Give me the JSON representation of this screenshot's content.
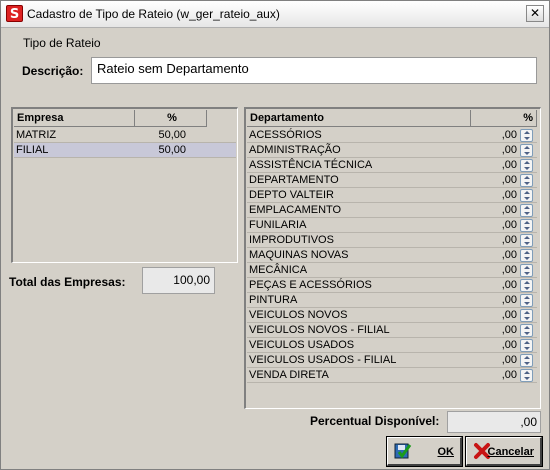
{
  "window": {
    "title": "Cadastro de Tipo de Rateio (w_ger_rateio_aux)",
    "close_glyph": "✕",
    "app_icon_letter": "S"
  },
  "form": {
    "group_title": "Tipo de Rateio",
    "description_label": "Descrição:",
    "description_value": "Rateio sem Departamento"
  },
  "empresas": {
    "headers": {
      "name": "Empresa",
      "pct": "%"
    },
    "rows": [
      {
        "name": "MATRIZ",
        "pct": "50,00"
      },
      {
        "name": "FILIAL",
        "pct": "50,00",
        "selected": true
      }
    ]
  },
  "total": {
    "label": "Total das Empresas:",
    "value": "100,00"
  },
  "departamentos": {
    "headers": {
      "name": "Departamento",
      "pct": "%"
    },
    "rows": [
      {
        "name": "ACESSÓRIOS",
        "pct": ",00"
      },
      {
        "name": "ADMINISTRAÇÃO",
        "pct": ",00"
      },
      {
        "name": "ASSISTÊNCIA TÉCNICA",
        "pct": ",00"
      },
      {
        "name": "DEPARTAMENTO",
        "pct": ",00"
      },
      {
        "name": "DEPTO VALTEIR",
        "pct": ",00"
      },
      {
        "name": "EMPLACAMENTO",
        "pct": ",00"
      },
      {
        "name": "FUNILARIA",
        "pct": ",00"
      },
      {
        "name": "IMPRODUTIVOS",
        "pct": ",00"
      },
      {
        "name": "MAQUINAS NOVAS",
        "pct": ",00"
      },
      {
        "name": "MECÂNICA",
        "pct": ",00"
      },
      {
        "name": "PEÇAS E ACESSÓRIOS",
        "pct": ",00"
      },
      {
        "name": "PINTURA",
        "pct": ",00"
      },
      {
        "name": "VEICULOS NOVOS",
        "pct": ",00"
      },
      {
        "name": "VEICULOS NOVOS - FILIAL",
        "pct": ",00"
      },
      {
        "name": "VEICULOS USADOS",
        "pct": ",00"
      },
      {
        "name": "VEICULOS USADOS - FILIAL",
        "pct": ",00"
      },
      {
        "name": "VENDA DIRETA",
        "pct": ",00"
      }
    ]
  },
  "available": {
    "label": "Percentual Disponível:",
    "value": ",00"
  },
  "buttons": {
    "ok": "OK",
    "cancel": "Cancelar"
  }
}
